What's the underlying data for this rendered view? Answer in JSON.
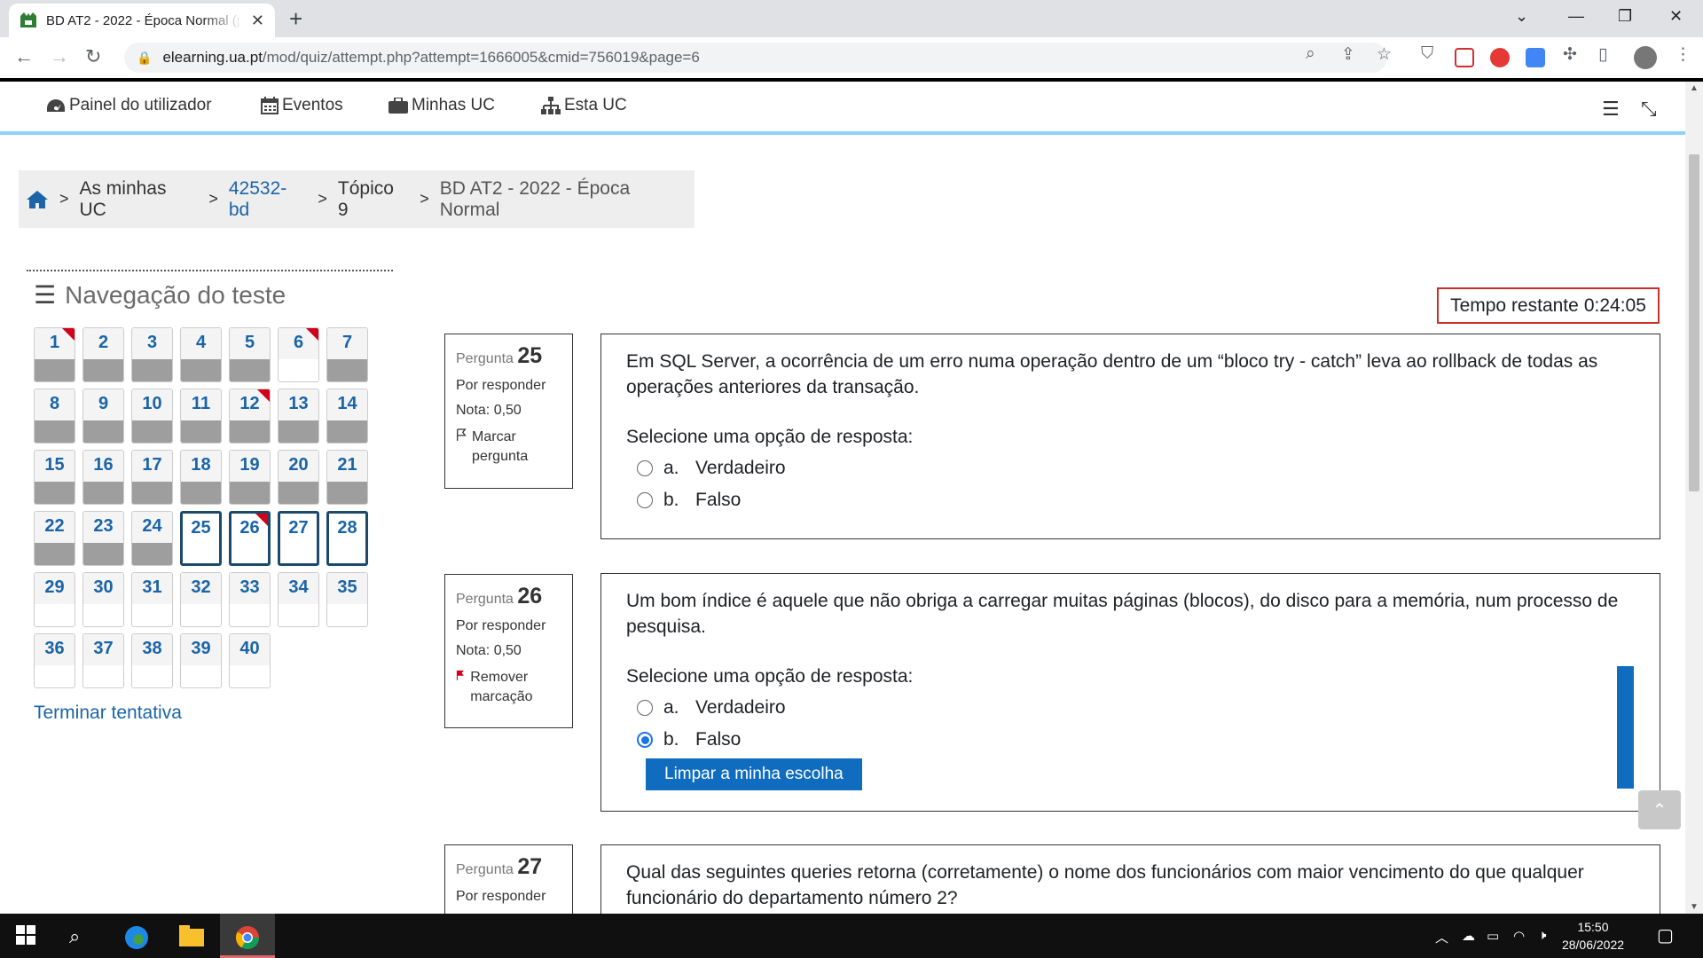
{
  "browser": {
    "tab_title": "BD AT2 - 2022 - Época Normal (p",
    "url_domain": "elearning.ua.pt",
    "url_path": "/mod/quiz/attempt.php?attempt=1666005&cmid=756019&page=6"
  },
  "navbar": {
    "items": [
      {
        "label": "Painel do utilizador",
        "icon": "dashboard-icon"
      },
      {
        "label": "Eventos",
        "icon": "calendar-icon"
      },
      {
        "label": "Minhas UC",
        "icon": "briefcase-icon"
      },
      {
        "label": "Esta UC",
        "icon": "sitemap-icon"
      }
    ]
  },
  "breadcrumb": {
    "items": [
      "As minhas UC",
      "42532-bd",
      "Tópico 9",
      "BD AT2 - 2022 - Época Normal"
    ]
  },
  "quiz_nav": {
    "title": "Navegação do teste",
    "finish_label": "Terminar tentativa",
    "buttons": [
      {
        "n": "1",
        "state": "answered",
        "flag": true
      },
      {
        "n": "2",
        "state": "answered",
        "flag": false
      },
      {
        "n": "3",
        "state": "answered",
        "flag": false
      },
      {
        "n": "4",
        "state": "answered",
        "flag": false
      },
      {
        "n": "5",
        "state": "answered",
        "flag": false
      },
      {
        "n": "6",
        "state": "blank",
        "flag": true
      },
      {
        "n": "7",
        "state": "answered",
        "flag": false
      },
      {
        "n": "8",
        "state": "answered",
        "flag": false
      },
      {
        "n": "9",
        "state": "answered",
        "flag": false
      },
      {
        "n": "10",
        "state": "answered",
        "flag": false
      },
      {
        "n": "11",
        "state": "answered",
        "flag": false
      },
      {
        "n": "12",
        "state": "answered",
        "flag": true
      },
      {
        "n": "13",
        "state": "answered",
        "flag": false
      },
      {
        "n": "14",
        "state": "answered",
        "flag": false
      },
      {
        "n": "15",
        "state": "answered",
        "flag": false
      },
      {
        "n": "16",
        "state": "answered",
        "flag": false
      },
      {
        "n": "17",
        "state": "answered",
        "flag": false
      },
      {
        "n": "18",
        "state": "answered",
        "flag": false
      },
      {
        "n": "19",
        "state": "answered",
        "flag": false
      },
      {
        "n": "20",
        "state": "answered",
        "flag": false
      },
      {
        "n": "21",
        "state": "answered",
        "flag": false
      },
      {
        "n": "22",
        "state": "answered",
        "flag": false
      },
      {
        "n": "23",
        "state": "answered",
        "flag": false
      },
      {
        "n": "24",
        "state": "answered",
        "flag": false
      },
      {
        "n": "25",
        "state": "current",
        "flag": false
      },
      {
        "n": "26",
        "state": "current",
        "flag": true
      },
      {
        "n": "27",
        "state": "current",
        "flag": false
      },
      {
        "n": "28",
        "state": "current",
        "flag": false
      },
      {
        "n": "29",
        "state": "blank",
        "flag": false
      },
      {
        "n": "30",
        "state": "blank",
        "flag": false
      },
      {
        "n": "31",
        "state": "blank",
        "flag": false
      },
      {
        "n": "32",
        "state": "blank",
        "flag": false
      },
      {
        "n": "33",
        "state": "blank",
        "flag": false
      },
      {
        "n": "34",
        "state": "blank",
        "flag": false
      },
      {
        "n": "35",
        "state": "blank",
        "flag": false
      },
      {
        "n": "36",
        "state": "blank",
        "flag": false
      },
      {
        "n": "37",
        "state": "blank",
        "flag": false
      },
      {
        "n": "38",
        "state": "blank",
        "flag": false
      },
      {
        "n": "39",
        "state": "blank",
        "flag": false
      },
      {
        "n": "40",
        "state": "blank",
        "flag": false
      }
    ]
  },
  "timer": {
    "label": "Tempo restante",
    "value": "0:24:05"
  },
  "questions": [
    {
      "label": "Pergunta",
      "number": "25",
      "status": "Por responder",
      "grade": "Nota: 0,50",
      "flag_action": "Marcar pergunta",
      "text": "Em SQL Server, a ocorrência de um erro numa operação dentro de um “bloco try - catch” leva ao rollback de todas as operações anteriores da transação.",
      "prompt": "Selecione uma opção de resposta:",
      "options": [
        {
          "letter": "a.",
          "text": "Verdadeiro"
        },
        {
          "letter": "b.",
          "text": "Falso"
        }
      ]
    },
    {
      "label": "Pergunta",
      "number": "26",
      "status": "Por responder",
      "grade": "Nota: 0,50",
      "flag_action": "Remover marcação",
      "text": "Um bom índice é aquele que não obriga a carregar muitas páginas (blocos), do disco para a memória, num processo de pesquisa.",
      "prompt": "Selecione uma opção de resposta:",
      "options": [
        {
          "letter": "a.",
          "text": "Verdadeiro"
        },
        {
          "letter": "b.",
          "text": "Falso"
        }
      ],
      "clear_label": "Limpar a minha escolha"
    },
    {
      "label": "Pergunta",
      "number": "27",
      "status": "Por responder",
      "text": "Qual das seguintes queries retorna (corretamente) o nome dos funcionários com maior vencimento do que qualquer funcionário do departamento número 2?"
    }
  ],
  "taskbar": {
    "time": "15:50",
    "date": "28/06/2022"
  },
  "colors": {
    "accent": "#0f6cbf",
    "link": "#1a64a7",
    "flag": "#d0021b",
    "timer_border": "#c9302c"
  }
}
